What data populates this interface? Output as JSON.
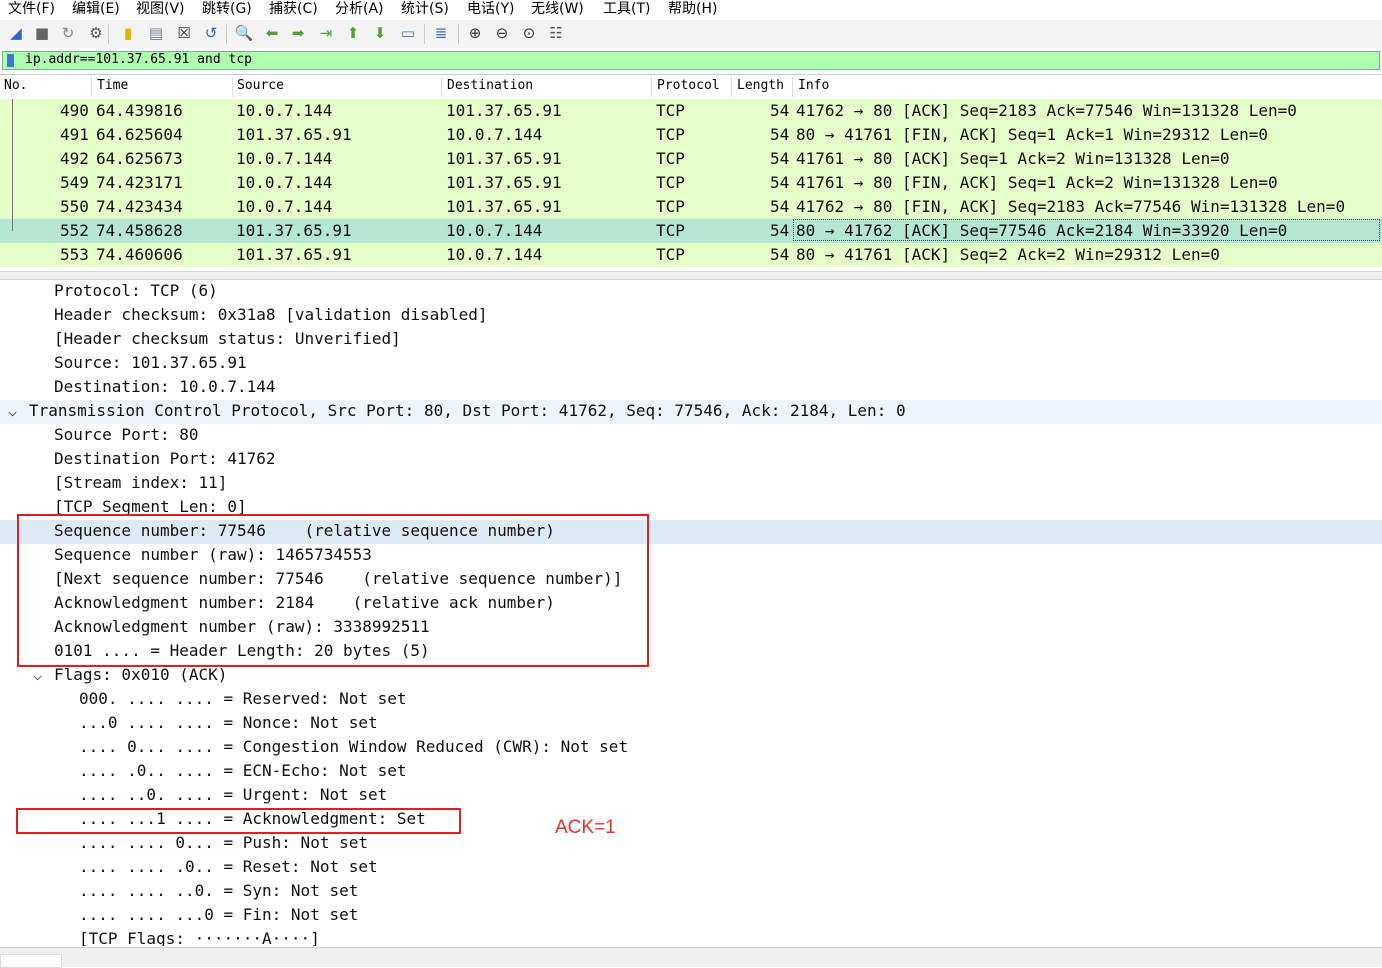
{
  "menu": [
    "文件(F)",
    "编辑(E)",
    "视图(V)",
    "跳转(G)",
    "捕获(C)",
    "分析(A)",
    "统计(S)",
    "电话(Y)",
    "无线(W)",
    "工具(T)",
    "帮助(H)"
  ],
  "toolbar": {
    "icons": [
      "shark-fin-start-icon",
      "stop-capture-icon",
      "restart-capture-icon",
      "capture-options-icon",
      "open-file-icon",
      "save-file-icon",
      "close-file-icon",
      "reload-icon",
      "find-packet-icon",
      "go-back-icon",
      "go-forward-icon",
      "go-to-packet-icon",
      "first-packet-icon",
      "last-packet-icon",
      "auto-scroll-icon",
      "colorize-icon",
      "zoom-in-icon",
      "zoom-out-icon",
      "zoom-normal-icon",
      "resize-columns-icon"
    ]
  },
  "filter": {
    "value": "ip.addr==101.37.65.91 and tcp"
  },
  "packet_list": {
    "columns": [
      "No.",
      "Time",
      "Source",
      "Destination",
      "Protocol",
      "Length",
      "Info"
    ],
    "rows": [
      {
        "no": "490",
        "time": "64.439816",
        "src": "10.0.7.144",
        "dst": "101.37.65.91",
        "proto": "TCP",
        "len": "54",
        "info": "41762 → 80 [ACK] Seq=2183 Ack=77546 Win=131328 Len=0"
      },
      {
        "no": "491",
        "time": "64.625604",
        "src": "101.37.65.91",
        "dst": "10.0.7.144",
        "proto": "TCP",
        "len": "54",
        "info": "80 → 41761 [FIN, ACK] Seq=1 Ack=1 Win=29312 Len=0"
      },
      {
        "no": "492",
        "time": "64.625673",
        "src": "10.0.7.144",
        "dst": "101.37.65.91",
        "proto": "TCP",
        "len": "54",
        "info": "41761 → 80 [ACK] Seq=1 Ack=2 Win=131328 Len=0"
      },
      {
        "no": "549",
        "time": "74.423171",
        "src": "10.0.7.144",
        "dst": "101.37.65.91",
        "proto": "TCP",
        "len": "54",
        "info": "41761 → 80 [FIN, ACK] Seq=1 Ack=2 Win=131328 Len=0"
      },
      {
        "no": "550",
        "time": "74.423434",
        "src": "10.0.7.144",
        "dst": "101.37.65.91",
        "proto": "TCP",
        "len": "54",
        "info": "41762 → 80 [FIN, ACK] Seq=2183 Ack=77546 Win=131328 Len=0"
      },
      {
        "no": "552",
        "time": "74.458628",
        "src": "101.37.65.91",
        "dst": "10.0.7.144",
        "proto": "TCP",
        "len": "54",
        "info": "80 → 41762 [ACK] Seq=77546 Ack=2184 Win=33920 Len=0",
        "selected": true
      },
      {
        "no": "553",
        "time": "74.460606",
        "src": "101.37.65.91",
        "dst": "10.0.7.144",
        "proto": "TCP",
        "len": "54",
        "info": "80 → 41761 [ACK] Seq=2 Ack=2 Win=29312 Len=0"
      }
    ]
  },
  "details": [
    {
      "text": "Protocol: TCP (6)",
      "level": 2
    },
    {
      "text": "Header checksum: 0x31a8 [validation disabled]",
      "level": 2
    },
    {
      "text": "[Header checksum status: Unverified]",
      "level": 2
    },
    {
      "text": "Source: 101.37.65.91",
      "level": 2
    },
    {
      "text": "Destination: 10.0.7.144",
      "level": 2
    },
    {
      "text": "Transmission Control Protocol, Src Port: 80, Dst Port: 41762, Seq: 77546, Ack: 2184, Len: 0",
      "level": 1,
      "expanded": true,
      "style": "hl"
    },
    {
      "text": "Source Port: 80",
      "level": 2
    },
    {
      "text": "Destination Port: 41762",
      "level": 2
    },
    {
      "text": "[Stream index: 11]",
      "level": 2
    },
    {
      "text": "[TCP Segment Len: 0]",
      "level": 2
    },
    {
      "text": "Sequence number: 77546    (relative sequence number)",
      "level": 2,
      "style": "sel"
    },
    {
      "text": "Sequence number (raw): 1465734553",
      "level": 2
    },
    {
      "text": "[Next sequence number: 77546    (relative sequence number)]",
      "level": 2
    },
    {
      "text": "Acknowledgment number: 2184    (relative ack number)",
      "level": 2
    },
    {
      "text": "Acknowledgment number (raw): 3338992511",
      "level": 2
    },
    {
      "text": "0101 .... = Header Length: 20 bytes (5)",
      "level": 2
    },
    {
      "text": "Flags: 0x010 (ACK)",
      "level": 2,
      "expanded": true
    },
    {
      "text": "000. .... .... = Reserved: Not set",
      "level": 3
    },
    {
      "text": "...0 .... .... = Nonce: Not set",
      "level": 3
    },
    {
      "text": ".... 0... .... = Congestion Window Reduced (CWR): Not set",
      "level": 3
    },
    {
      "text": ".... .0.. .... = ECN-Echo: Not set",
      "level": 3
    },
    {
      "text": ".... ..0. .... = Urgent: Not set",
      "level": 3
    },
    {
      "text": ".... ...1 .... = Acknowledgment: Set",
      "level": 3
    },
    {
      "text": ".... .... 0... = Push: Not set",
      "level": 3
    },
    {
      "text": ".... .... .0.. = Reset: Not set",
      "level": 3
    },
    {
      "text": ".... .... ..0. = Syn: Not set",
      "level": 3
    },
    {
      "text": ".... .... ...0 = Fin: Not set",
      "level": 3
    },
    {
      "text": "[TCP Flags: ·······A····]",
      "level": 3
    }
  ],
  "annotation": {
    "text": "ACK=1",
    "color": "#e53030"
  },
  "colors": {
    "row_bg": "#e4ffc7",
    "row_selected_bg": "#b5e6d4",
    "filter_bg": "#afffaf",
    "highlight_box": "#e02020"
  }
}
